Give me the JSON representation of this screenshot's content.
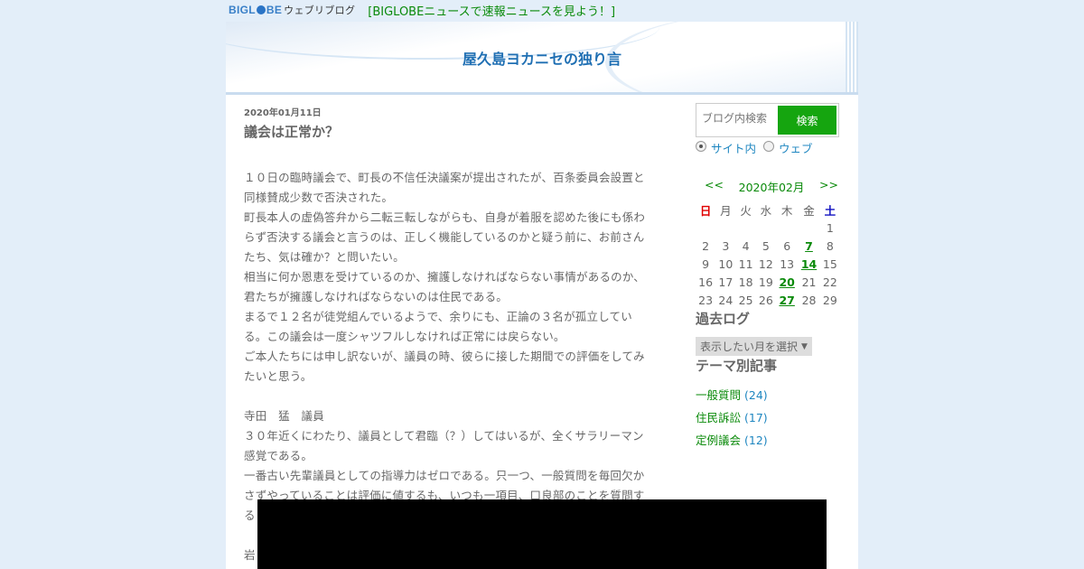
{
  "topbar": {
    "logo_big": "BIGL",
    "logo_be": "BE",
    "logo_web": "ウェブリブログ",
    "link": "[BIGLOBEニュースで速報ニュースを見よう！]"
  },
  "blog": {
    "title": "屋久島ヨカニセの独り言"
  },
  "post": {
    "date": "2020年01月11日",
    "title": "議会は正常か？",
    "lines": [
      "１０日の臨時議会で、町長の不信任決議案が提出されたが、百条委員会設置と",
      "同様賛成少数で否決された。",
      "町長本人の虚偽答弁から二転三転しながらも、自身が着服を認めた後にも係わ",
      "らず否決する議会と言うのは、正しく機能しているのかと疑う前に、お前さん",
      "たち、気は確か？と問いたい。",
      "相当に何か恩恵を受けているのか、擁護しなければならない事情があるのか、",
      "君たちが擁護しなければならないのは住民である。",
      "まるで１２名が徒党組んでいるようで、余りにも、正論の３名が孤立してい",
      "る。この議会は一度シャツフルしなければ正常には戻らない。",
      "ご本人たちには申し訳ないが、議員の時、彼らに接した期間での評価をしてみ",
      "たいと思う。",
      "",
      "寺田　猛　議員",
      "３０年近くにわたり、議員として君臨（？）してはいるが、全くサラリーマン",
      "感覚である。",
      "一番古い先輩議員としての指導力はゼロである。只一つ、一般質問を毎回欠か",
      "さずやっていることは評価に値するも、いつも一項目、口良部のことを質問す",
      "る",
      "",
      "岩"
    ]
  },
  "sidebar": {
    "search_placeholder": "ブログ内検索",
    "search_button": "検索",
    "radio_site": "サイト内",
    "radio_web": "ウェブ",
    "calendar": {
      "prev": "<<",
      "month": "2020年02月",
      "next": ">>",
      "weekdays": [
        "日",
        "月",
        "火",
        "水",
        "木",
        "金",
        "土"
      ],
      "weeks": [
        [
          "",
          "",
          "",
          "",
          "",
          "",
          "1"
        ],
        [
          "2",
          "3",
          "4",
          "5",
          "6",
          "7",
          "8"
        ],
        [
          "9",
          "10",
          "11",
          "12",
          "13",
          "14",
          "15"
        ],
        [
          "16",
          "17",
          "18",
          "19",
          "20",
          "21",
          "22"
        ],
        [
          "23",
          "24",
          "25",
          "26",
          "27",
          "28",
          "29"
        ]
      ],
      "linked_days": [
        "7",
        "14",
        "20",
        "27"
      ]
    },
    "archive_heading": "過去ログ",
    "archive_select": "表示したい月を選択",
    "theme_heading": "テーマ別記事",
    "themes": [
      {
        "name": "一般質問",
        "count": "(24)"
      },
      {
        "name": "住民訴訟",
        "count": "(17)"
      },
      {
        "name": "定例議会",
        "count": "(12)"
      }
    ]
  },
  "colors": {
    "accent_green": "#15a50f",
    "title_blue": "#1f6fb3",
    "link_green": "#0a8a0a",
    "page_bg": "#e3eef9"
  }
}
